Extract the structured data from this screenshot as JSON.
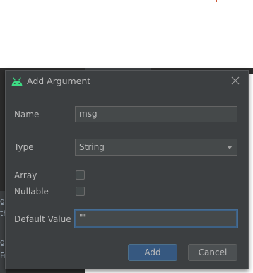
{
  "dialog": {
    "title": "Add Argument",
    "icon": "android-icon",
    "close_icon": "close-icon"
  },
  "form": {
    "name_label": "Name",
    "name_value": "msg",
    "type_label": "Type",
    "type_value": "String",
    "array_label": "Array",
    "array_checked": false,
    "nullable_label": "Nullable",
    "nullable_checked": false,
    "default_label": "Default Value",
    "default_value": "\"\""
  },
  "buttons": {
    "add_label": "Add",
    "cancel_label": "Cancel"
  },
  "background": {
    "fragment_1": "gr",
    "fragment_2": "th",
    "fragment_3": "g",
    "fragment_4": "Fr"
  },
  "colors": {
    "dialog_bg": "#3c3f41",
    "primary_button": "#365880",
    "focus_border": "#3d6185",
    "android_green": "#3ddc84"
  }
}
